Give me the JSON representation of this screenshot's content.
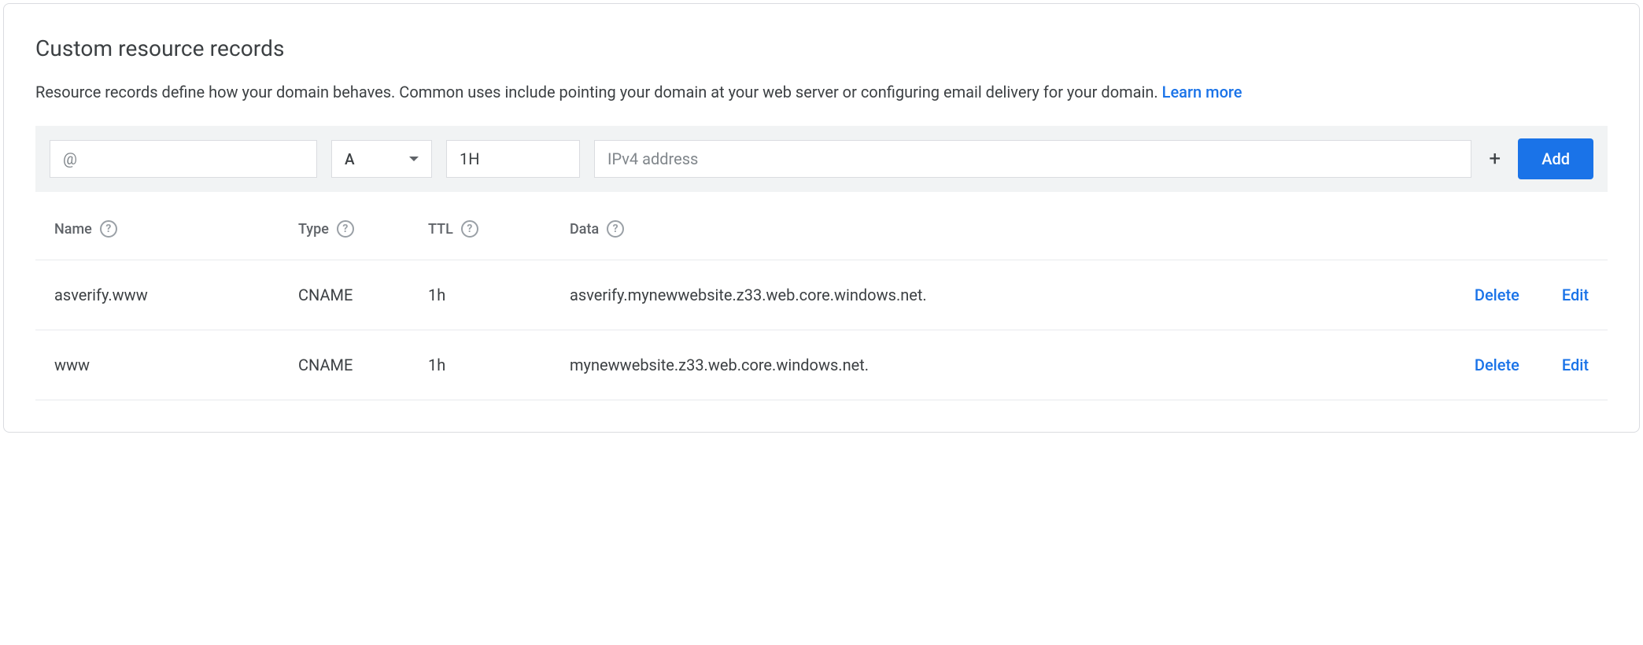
{
  "header": {
    "title": "Custom resource records",
    "description": "Resource records define how your domain behaves. Common uses include pointing your domain at your web server or configuring email delivery for your domain.",
    "learn_more": "Learn more"
  },
  "form": {
    "name_placeholder": "@",
    "type_value": "A",
    "ttl_value": "1H",
    "data_placeholder": "IPv4 address",
    "add_label": "Add"
  },
  "table": {
    "columns": {
      "name": "Name",
      "type": "Type",
      "ttl": "TTL",
      "data": "Data"
    },
    "actions": {
      "delete": "Delete",
      "edit": "Edit"
    },
    "rows": [
      {
        "name": "asverify.www",
        "type": "CNAME",
        "ttl": "1h",
        "data": "asverify.mynewwebsite.z33.web.core.windows.net."
      },
      {
        "name": "www",
        "type": "CNAME",
        "ttl": "1h",
        "data": "mynewwebsite.z33.web.core.windows.net."
      }
    ]
  }
}
